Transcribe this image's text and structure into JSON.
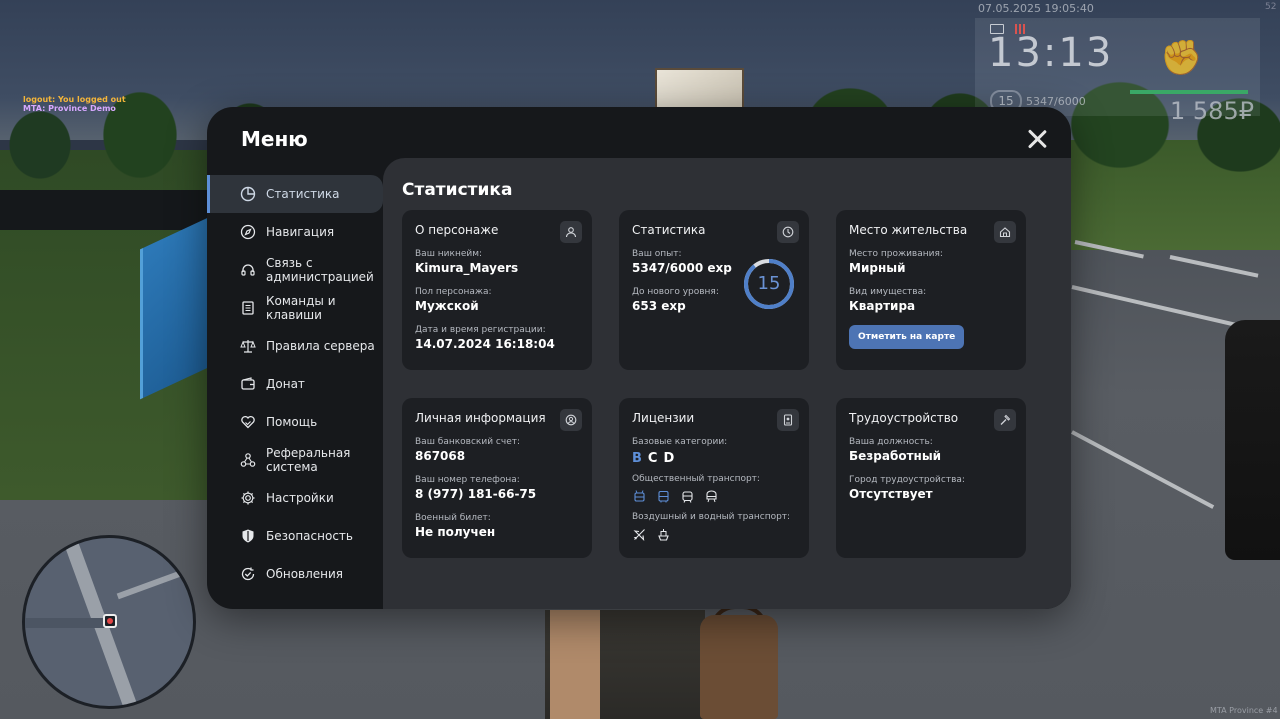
{
  "hud": {
    "datetime": "07.05.2025 19:05:40",
    "corner": "52",
    "time": "13:13",
    "level": "15",
    "exp": "5347/6000",
    "money": "1 585₽",
    "chat": [
      "logout: You logged out",
      "MTA: Province Demo"
    ],
    "watermark": "MTA Province #4"
  },
  "menu": {
    "title": "Меню",
    "sidebar": [
      {
        "label": "Статистика",
        "icon": "pie-chart-icon",
        "active": true
      },
      {
        "label": "Навигация",
        "icon": "compass-icon"
      },
      {
        "label": "Связь с администрацией",
        "icon": "headset-icon"
      },
      {
        "label": "Команды и клавиши",
        "icon": "document-icon"
      },
      {
        "label": "Правила сервера",
        "icon": "scales-icon"
      },
      {
        "label": "Донат",
        "icon": "wallet-icon"
      },
      {
        "label": "Помощь",
        "icon": "handshake-heart-icon"
      },
      {
        "label": "Реферальная система",
        "icon": "referral-network-icon"
      },
      {
        "label": "Настройки",
        "icon": "gear-icon"
      },
      {
        "label": "Безопасность",
        "icon": "shield-icon"
      },
      {
        "label": "Обновления",
        "icon": "update-check-icon"
      }
    ]
  },
  "stats": {
    "title": "Статистика",
    "character": {
      "title": "О персонаже",
      "nick_label": "Ваш никнейм:",
      "nick": "Kimura_Mayers",
      "gender_label": "Пол персонажа:",
      "gender": "Мужской",
      "reg_label": "Дата и время регистрации:",
      "reg": "14.07.2024 16:18:04"
    },
    "statistics": {
      "title": "Статистика",
      "exp_label": "Ваш опыт:",
      "exp": "5347/6000 exp",
      "next_label": "До нового уровня:",
      "next": "653 exp",
      "level": "15",
      "level_progress": 0.891
    },
    "residence": {
      "title": "Место жительства",
      "place_label": "Место проживания:",
      "place": "Мирный",
      "property_label": "Вид имущества:",
      "property": "Квартира",
      "button": "Отметить на карте"
    },
    "personal": {
      "title": "Личная информация",
      "bank_label": "Ваш банковский счет:",
      "bank": "867068",
      "phone_label": "Ваш номер телефона:",
      "phone": "8 (977) 181-66-75",
      "military_label": "Военный билет:",
      "military": "Не получен"
    },
    "licenses": {
      "title": "Лицензии",
      "base_label": "Базовые категории:",
      "categories": [
        "B",
        "C",
        "D"
      ],
      "public_label": "Общественный транспорт:",
      "air_label": "Воздушный и водный транспорт:"
    },
    "employment": {
      "title": "Трудоустройство",
      "position_label": "Ваша должность:",
      "position": "Безработный",
      "city_label": "Город трудоустройства:",
      "city": "Отсутствует"
    }
  },
  "colors": {
    "accent": "#5e8fd8",
    "button": "#4d74b4",
    "window": "#16181b",
    "card": "#1d1f23"
  }
}
